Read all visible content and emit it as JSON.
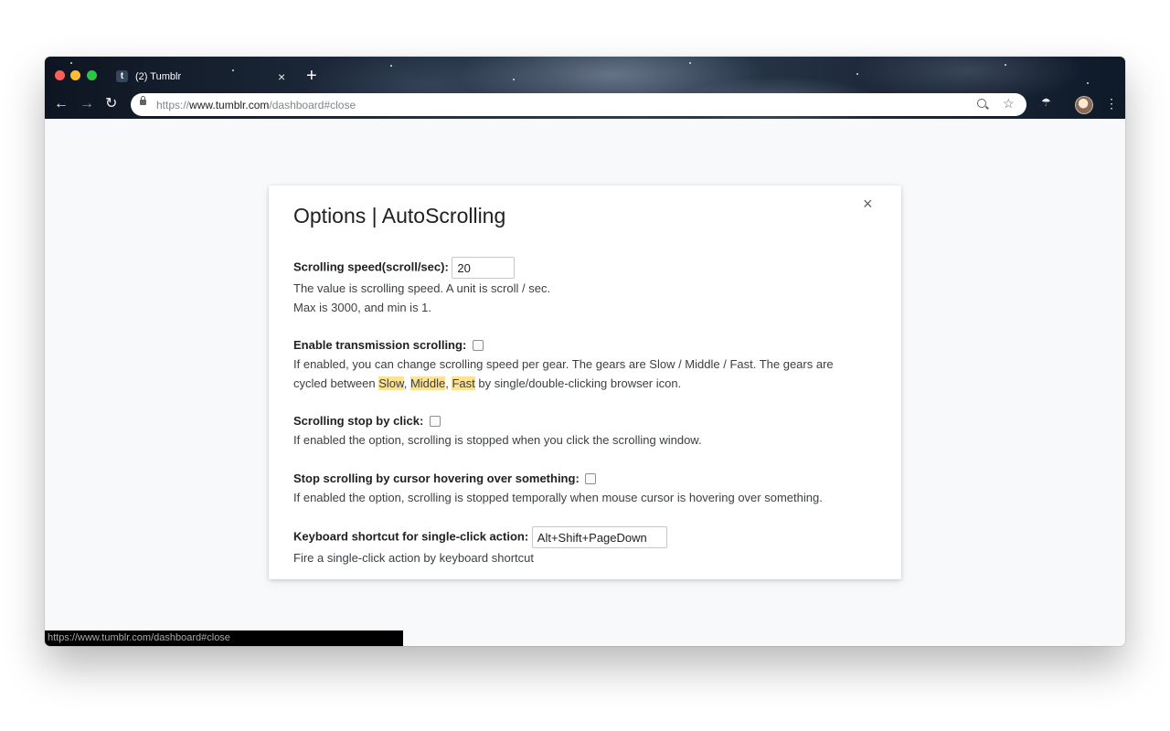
{
  "browser": {
    "tab_favicon_letter": "t",
    "tab_title": "(2) Tumblr",
    "tab_close": "×",
    "new_tab": "+",
    "nav_back": "←",
    "nav_forward": "→",
    "nav_reload": "↻",
    "url_scheme": "https://",
    "url_host": "www.tumblr.com",
    "url_path": "/dashboard#close",
    "bookmark_glyph": "☆",
    "menu_glyph": "⋮",
    "extension_glyph": "☂"
  },
  "options": {
    "title": "Options | AutoScrolling",
    "close_glyph": "×",
    "speed": {
      "label": "Scrolling speed(scroll/sec):",
      "value": "20",
      "desc1": "The value is scrolling speed. A unit is scroll / sec.",
      "desc2": "Max is 3000, and min is 1."
    },
    "transmission": {
      "label": "Enable transmission scrolling:",
      "checked": false,
      "desc1": "If enabled, you can change scrolling speed per gear. The gears are Slow / Middle / Fast. The gears are",
      "desc2_prefix": "cycled between ",
      "gear_slow": "Slow",
      "sep1": ", ",
      "gear_middle": "Middle",
      "sep2": ", ",
      "gear_fast": "Fast",
      "desc2_suffix": " by single/double-clicking browser icon."
    },
    "stop_click": {
      "label": "Scrolling stop by click:",
      "checked": false,
      "desc": "If enabled the option, scrolling is stopped when you click the scrolling window."
    },
    "stop_hover": {
      "label": "Stop scrolling by cursor hovering over something:",
      "checked": false,
      "desc": "If enabled the option, scrolling is stopped temporally when mouse cursor is hovering over something."
    },
    "shortcut": {
      "label": "Keyboard shortcut for single-click action:",
      "value": "Alt+Shift+PageDown",
      "desc": "Fire a single-click action by keyboard shortcut"
    }
  },
  "status_bar": {
    "text": "https://www.tumblr.com/dashboard#close"
  }
}
